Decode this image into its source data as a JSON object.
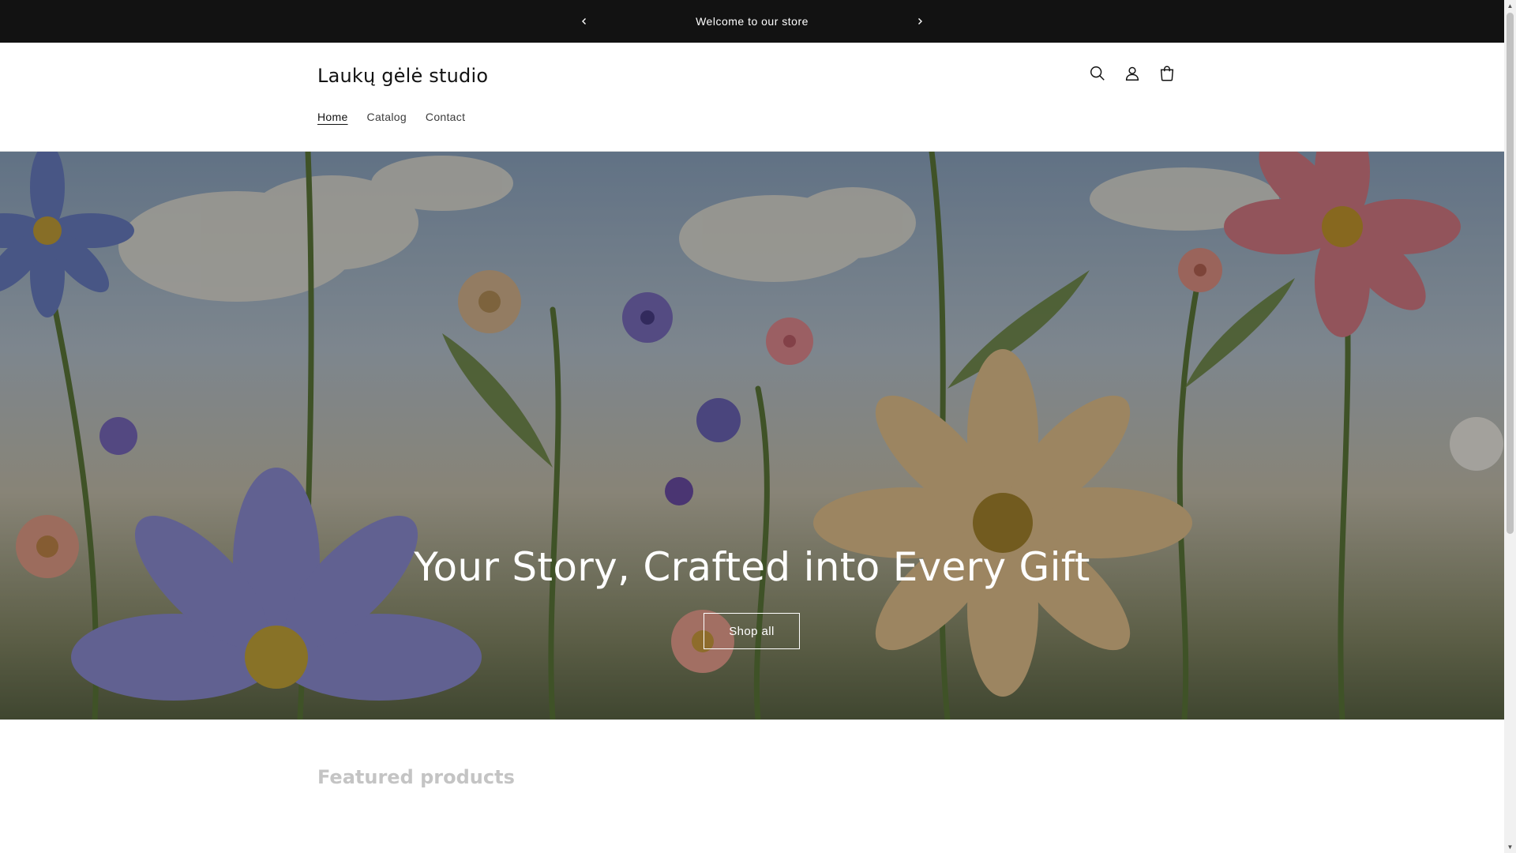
{
  "announcement": {
    "text": "Welcome to our store",
    "prev_icon": "chevron-left-icon",
    "next_icon": "chevron-right-icon"
  },
  "header": {
    "logo": "Laukų gėlė studio",
    "nav": [
      {
        "label": "Home",
        "active": true
      },
      {
        "label": "Catalog",
        "active": false
      },
      {
        "label": "Contact",
        "active": false
      }
    ],
    "icons": [
      "search-icon",
      "account-icon",
      "cart-icon"
    ]
  },
  "hero": {
    "title": "Your Story, Crafted into Every Gift",
    "button_label": "Shop all"
  },
  "featured": {
    "title": "Featured products"
  },
  "colors": {
    "announcement_bg": "#121212",
    "text": "#121212",
    "muted": "#c4c4c4"
  }
}
